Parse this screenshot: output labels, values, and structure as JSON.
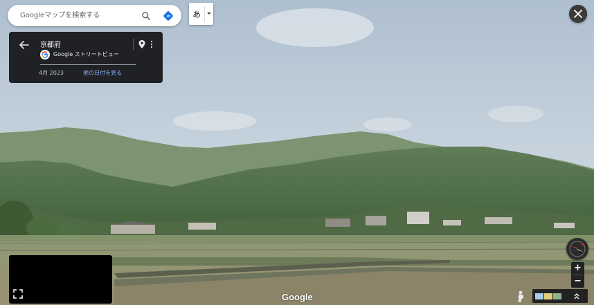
{
  "search": {
    "placeholder": "Googleマップを検索する"
  },
  "ime": {
    "char": "あ"
  },
  "card": {
    "title": "京都府",
    "provider": "Google ストリートビュー",
    "date": "4月 2023",
    "more_dates_link": "他の日付を見る"
  },
  "wordmark": "Google",
  "zoom": {
    "in": "+",
    "out": "−"
  },
  "colors": {
    "card_bg": "#202124",
    "link": "#8ab4f8",
    "directions_blue": "#1a73e8",
    "compass_red": "#e53935"
  },
  "icons": [
    "search-icon",
    "directions-icon",
    "chevron-down-icon",
    "close-icon",
    "back-arrow-icon",
    "google-g-icon",
    "map-pin-icon",
    "more-vert-icon",
    "expand-icon",
    "compass-icon",
    "pegman-icon",
    "layers-expand-icon"
  ]
}
